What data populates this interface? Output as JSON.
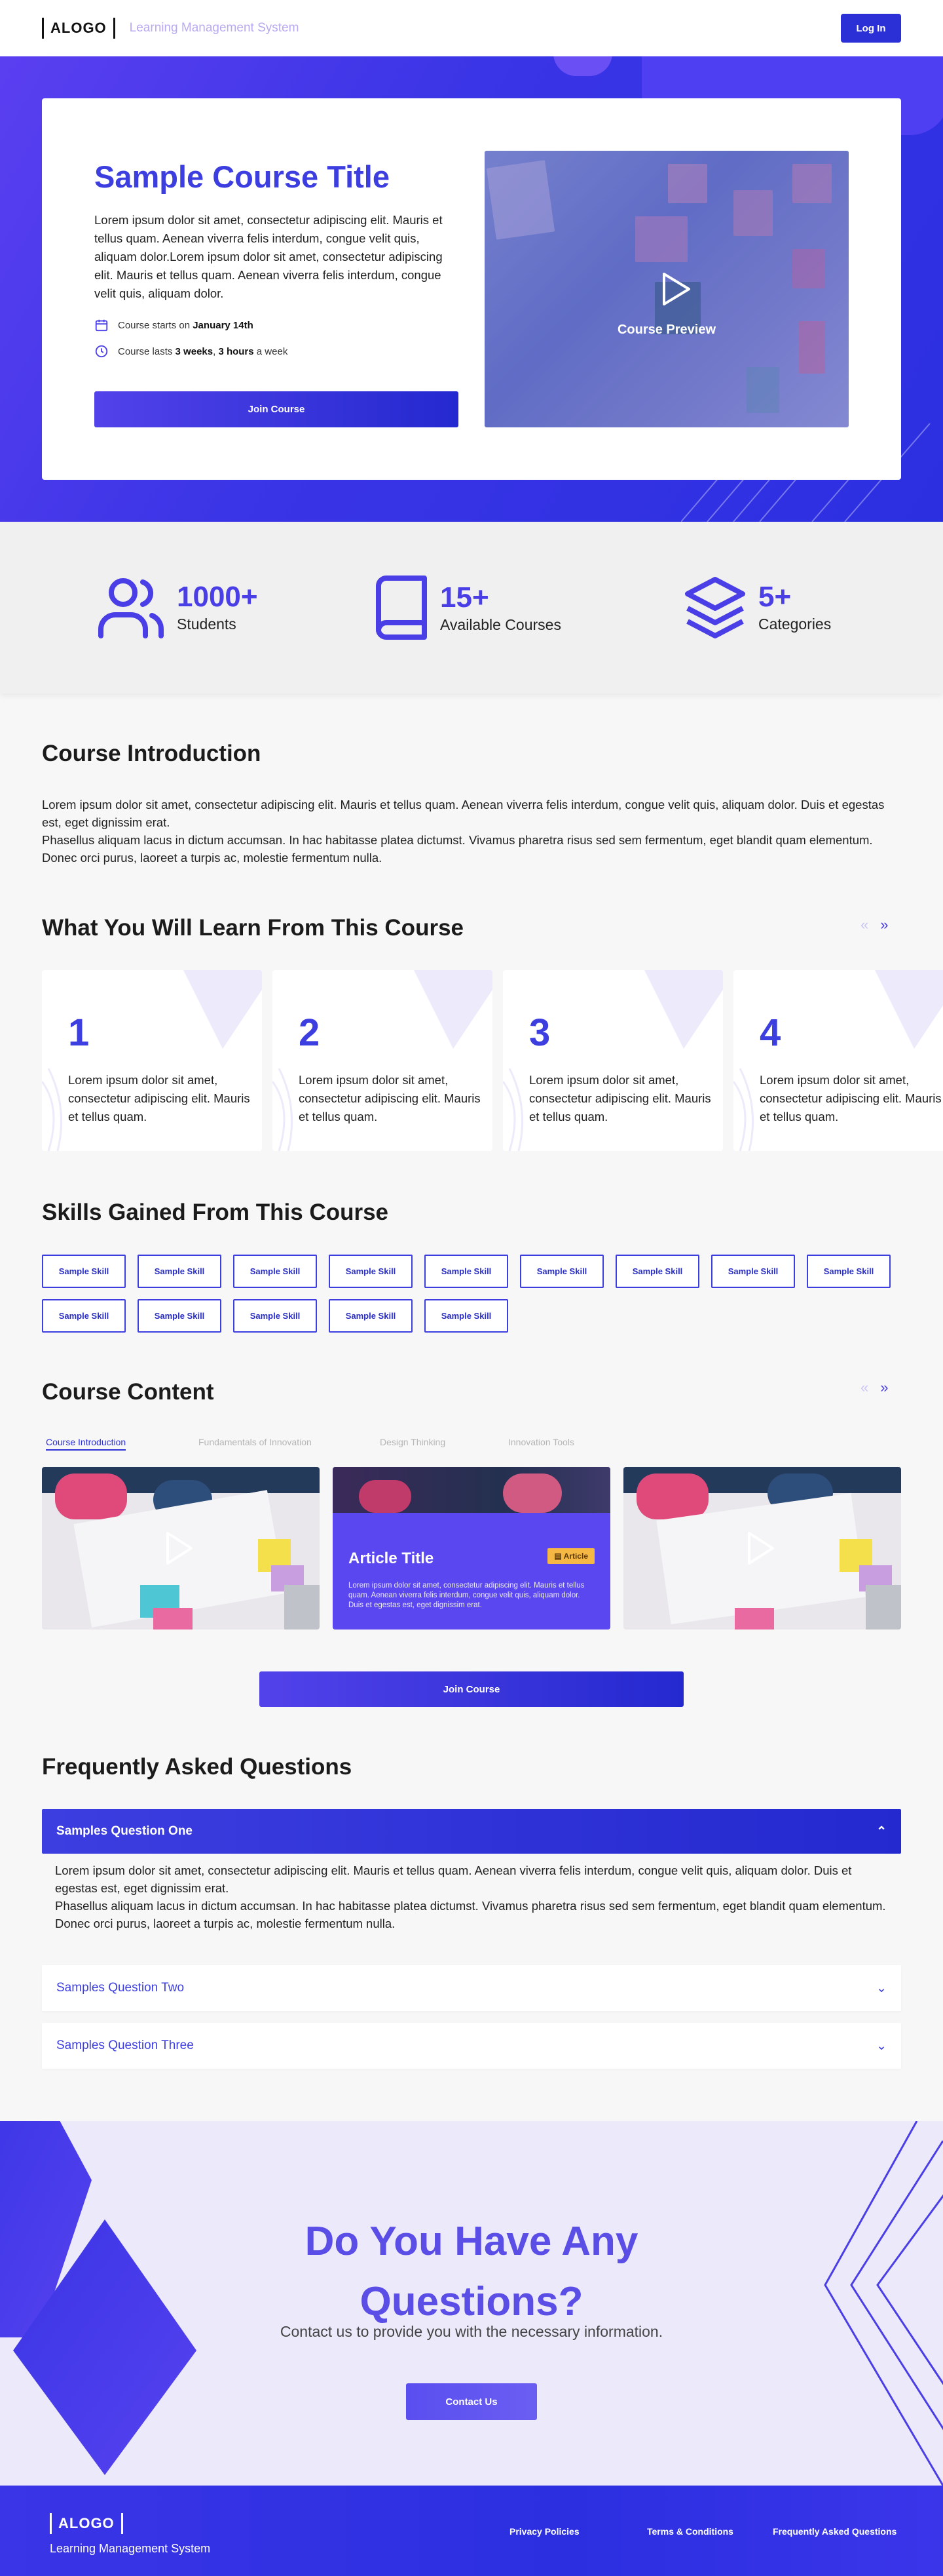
{
  "header": {
    "logo": "ALOGO",
    "subtitle": "Learning Management System",
    "login_label": "Log In"
  },
  "hero": {
    "title": "Sample Course Title",
    "description": "Lorem ipsum dolor sit amet, consectetur adipiscing elit. Mauris et tellus quam. Aenean viverra felis interdum, congue velit quis, aliquam dolor.Lorem ipsum dolor sit amet, consectetur adipiscing elit. Mauris et tellus quam. Aenean viverra felis interdum, congue velit quis, aliquam dolor.",
    "start_prefix": "Course starts on ",
    "start_date": "January 14th",
    "duration_prefix": "Course lasts ",
    "duration_weeks": "3 weeks",
    "duration_sep": ", ",
    "duration_hours": "3 hours",
    "duration_suffix": " a week",
    "join_label": "Join Course",
    "preview_label": "Course Preview"
  },
  "stats": [
    {
      "number": "1000+",
      "label": "Students",
      "icon": "users-icon"
    },
    {
      "number": "15+",
      "label": "Available Courses",
      "icon": "book-icon"
    },
    {
      "number": "5+",
      "label": "Categories",
      "icon": "layers-icon"
    }
  ],
  "intro": {
    "heading": "Course Introduction",
    "p1": "Lorem ipsum dolor sit amet, consectetur adipiscing elit. Mauris et tellus quam. Aenean viverra felis interdum, congue velit quis, aliquam dolor. Duis et egestas est, eget dignissim erat.",
    "p2": "Phasellus aliquam lacus in dictum accumsan. In hac habitasse platea dictumst. Vivamus pharetra risus sed sem fermentum, eget blandit quam elementum. Donec orci purus, laoreet a turpis ac, molestie fermentum nulla."
  },
  "learn": {
    "heading": "What You Will Learn From This Course",
    "cards": [
      {
        "number": "1",
        "text": "Lorem ipsum dolor sit amet, consectetur adipiscing elit. Mauris et tellus quam."
      },
      {
        "number": "2",
        "text": "Lorem ipsum dolor sit amet, consectetur adipiscing elit. Mauris et tellus quam."
      },
      {
        "number": "3",
        "text": "Lorem ipsum dolor sit amet, consectetur adipiscing elit. Mauris et tellus quam."
      },
      {
        "number": "4",
        "text": "Lorem ipsum dolor sit amet, consectetur adipiscing elit. Mauris et tellus quam."
      }
    ]
  },
  "skills": {
    "heading": "Skills Gained From This Course",
    "items": [
      "Sample Skill",
      "Sample Skill",
      "Sample Skill",
      "Sample Skill",
      "Sample Skill",
      "Sample Skill",
      "Sample Skill",
      "Sample Skill",
      "Sample Skill",
      "Sample Skill",
      "Sample Skill",
      "Sample Skill",
      "Sample Skill",
      "Sample Skill"
    ]
  },
  "content": {
    "heading": "Course Content",
    "tabs": [
      "Course Introduction",
      "Fundamentals of Innovation",
      "Design Thinking",
      "Innovation Tools"
    ],
    "article": {
      "title": "Article Title",
      "badge": "Article",
      "text": "Lorem ipsum dolor sit amet, consectetur adipiscing elit. Mauris et tellus quam. Aenean viverra felis interdum, congue velit quis, aliquam dolor. Duis et egestas est, eget dignissim erat."
    },
    "join_label": "Join Course"
  },
  "faq": {
    "heading": "Frequently Asked Questions",
    "open_question": "Samples Question One",
    "answer_p1": "Lorem ipsum dolor sit amet, consectetur adipiscing elit. Mauris et tellus quam. Aenean viverra felis interdum, congue velit quis, aliquam dolor. Duis et egestas est, eget dignissim erat.",
    "answer_p2": "Phasellus aliquam lacus in dictum accumsan. In hac habitasse platea dictumst. Vivamus pharetra risus sed sem fermentum, eget blandit quam elementum. Donec orci purus, laoreet a turpis ac, molestie fermentum nulla.",
    "questions": [
      "Samples Question Two",
      "Samples Question Three"
    ]
  },
  "cta": {
    "title_line1": "Do You Have Any",
    "title_line2": "Questions?",
    "subtitle": "Contact us to provide you with the necessary information.",
    "button": "Contact Us"
  },
  "footer": {
    "logo": "ALOGO",
    "subtitle": "Learning Management System",
    "links": [
      "Privacy Policies",
      "Terms & Conditions",
      "Frequently Asked Questions"
    ]
  },
  "colors": {
    "primary": "#3d3ee0",
    "accent": "#5a47f0",
    "badge": "#f5b844"
  }
}
